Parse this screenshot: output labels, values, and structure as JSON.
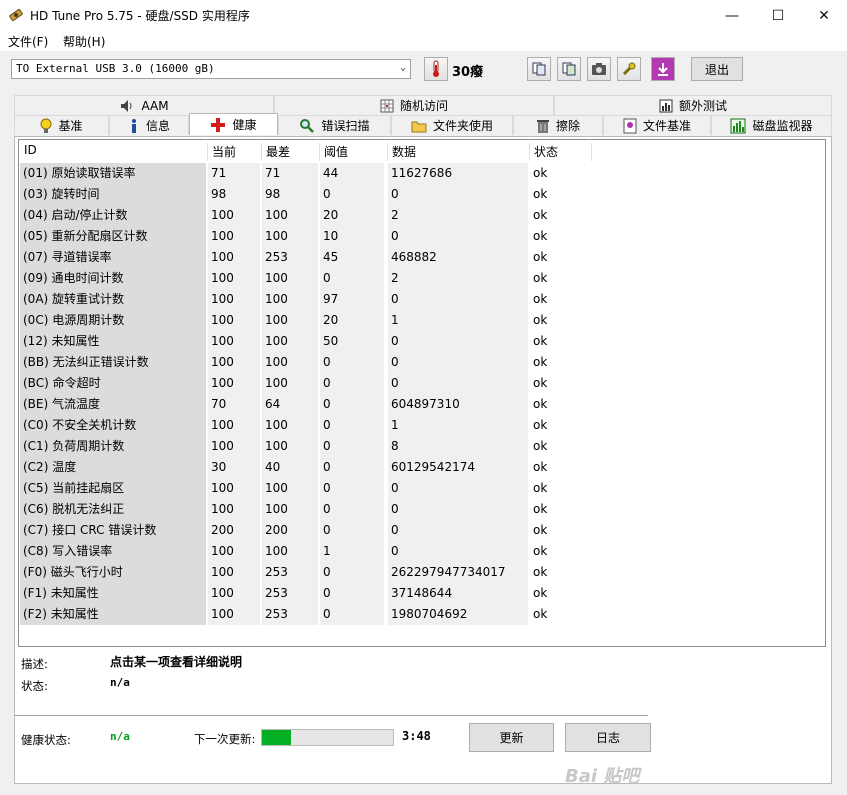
{
  "window": {
    "title": "HD Tune Pro 5.75 - 硬盘/SSD 实用程序",
    "minimize": "—",
    "maximize": "☐",
    "close": "✕"
  },
  "menu": {
    "file": "文件(F)",
    "help": "帮助(H)"
  },
  "toolbar": {
    "drive": "TO External USB 3.0 (16000 gB)",
    "temperature": "30癈",
    "exit": "退出"
  },
  "tabs_top": [
    {
      "label": "AAM",
      "icon": "speaker-icon"
    },
    {
      "label": "随机访问",
      "icon": "grid-icon"
    },
    {
      "label": "额外测试",
      "icon": "chart-icon"
    }
  ],
  "tabs_bottom": [
    {
      "label": "基准",
      "icon": "bulb-icon"
    },
    {
      "label": "信息",
      "icon": "info-icon"
    },
    {
      "label": "健康",
      "icon": "red-cross-icon"
    },
    {
      "label": "错误扫描",
      "icon": "magnifier-icon"
    },
    {
      "label": "文件夹使用",
      "icon": "folder-icon"
    },
    {
      "label": "擦除",
      "icon": "trash-icon"
    },
    {
      "label": "文件基准",
      "icon": "file-bulb-icon"
    },
    {
      "label": "磁盘监视器",
      "icon": "monitor-chart-icon"
    }
  ],
  "table": {
    "headers": [
      "ID",
      "当前",
      "最差",
      "阈值",
      "数据",
      "状态"
    ],
    "rows": [
      [
        "(01) 原始读取错误率",
        "71",
        "71",
        "44",
        "11627686",
        "ok"
      ],
      [
        "(03) 旋转时间",
        "98",
        "98",
        "0",
        "0",
        "ok"
      ],
      [
        "(04) 启动/停止计数",
        "100",
        "100",
        "20",
        "2",
        "ok"
      ],
      [
        "(05) 重新分配扇区计数",
        "100",
        "100",
        "10",
        "0",
        "ok"
      ],
      [
        "(07) 寻道错误率",
        "100",
        "253",
        "45",
        "468882",
        "ok"
      ],
      [
        "(09) 通电时间计数",
        "100",
        "100",
        "0",
        "2",
        "ok"
      ],
      [
        "(0A) 旋转重试计数",
        "100",
        "100",
        "97",
        "0",
        "ok"
      ],
      [
        "(0C) 电源周期计数",
        "100",
        "100",
        "20",
        "1",
        "ok"
      ],
      [
        "(12) 未知属性",
        "100",
        "100",
        "50",
        "0",
        "ok"
      ],
      [
        "(BB) 无法纠正错误计数",
        "100",
        "100",
        "0",
        "0",
        "ok"
      ],
      [
        "(BC) 命令超时",
        "100",
        "100",
        "0",
        "0",
        "ok"
      ],
      [
        "(BE) 气流温度",
        "70",
        "64",
        "0",
        "604897310",
        "ok"
      ],
      [
        "(C0) 不安全关机计数",
        "100",
        "100",
        "0",
        "1",
        "ok"
      ],
      [
        "(C1) 负荷周期计数",
        "100",
        "100",
        "0",
        "8",
        "ok"
      ],
      [
        "(C2) 温度",
        "30",
        "40",
        "0",
        "60129542174",
        "ok"
      ],
      [
        "(C5) 当前挂起扇区",
        "100",
        "100",
        "0",
        "0",
        "ok"
      ],
      [
        "(C6) 脱机无法纠正",
        "100",
        "100",
        "0",
        "0",
        "ok"
      ],
      [
        "(C7) 接口 CRC 错误计数",
        "200",
        "200",
        "0",
        "0",
        "ok"
      ],
      [
        "(C8) 写入错误率",
        "100",
        "100",
        "1",
        "0",
        "ok"
      ],
      [
        "(F0) 磁头飞行小时",
        "100",
        "253",
        "0",
        "262297947734017",
        "ok"
      ],
      [
        "(F1) 未知属性",
        "100",
        "253",
        "0",
        "37148644",
        "ok"
      ],
      [
        "(F2) 未知属性",
        "100",
        "253",
        "0",
        "1980704692",
        "ok"
      ]
    ]
  },
  "details": {
    "desc_label": "描述:",
    "desc_value": "点击某一项查看详细说明",
    "status_label": "状态:",
    "status_value": "n/a"
  },
  "footer": {
    "health_label": "健康状态:",
    "health_value": "n/a",
    "health_color": "#0a9a1e",
    "next_update_label": "下一次更新:",
    "progress_fraction": 0.22,
    "time": "3:48",
    "update_button": "更新",
    "log_button": "日志"
  },
  "watermark": "Bai 贴吧"
}
